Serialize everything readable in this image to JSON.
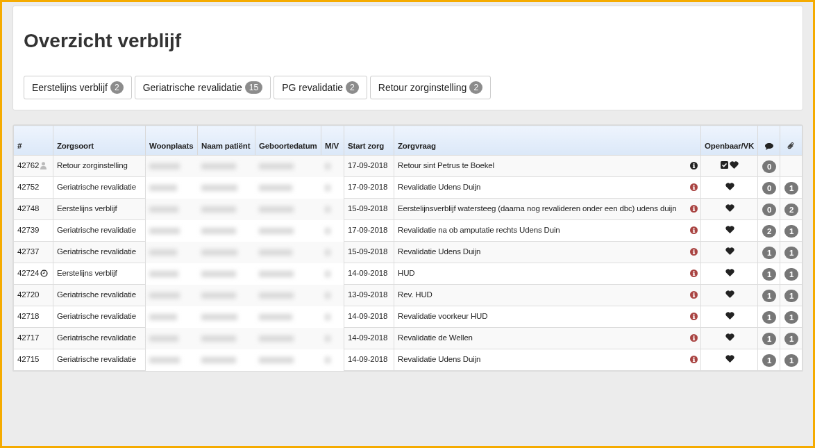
{
  "page": {
    "title": "Overzicht verblijf"
  },
  "filters": [
    {
      "label": "Eerstelijns verblijf",
      "count": "2"
    },
    {
      "label": "Geriatrische revalidatie",
      "count": "15"
    },
    {
      "label": "PG revalidatie",
      "count": "2"
    },
    {
      "label": "Retour zorginstelling",
      "count": "2"
    }
  ],
  "table": {
    "columns": [
      "#",
      "Zorgsoort",
      "Woonplaats",
      "Naam patiënt",
      "Geboortedatum",
      "M/V",
      "Start zorg",
      "Zorgvraag",
      "Openbaar/VK"
    ],
    "rows": [
      {
        "id": "42762",
        "kind": "person",
        "zorgsoort": "Retour zorginstelling",
        "start": "17-09-2018",
        "zorgvraag": "Retour sint Petrus te Boekel",
        "color": "#222222",
        "openbaar": true,
        "comments": "0"
      },
      {
        "id": "42752",
        "kind": "plain",
        "zorgsoort": "Geriatrische revalidatie",
        "start": "17-09-2018",
        "zorgvraag": "Revalidatie Udens Duijn",
        "color": "#a94442",
        "openbaar": false,
        "comments": "0",
        "attachments": "1"
      },
      {
        "id": "42748",
        "kind": "plain",
        "zorgsoort": "Eerstelijns verblijf",
        "start": "15-09-2018",
        "zorgvraag": "Eerstelijnsverblijf watersteeg (daarna nog revalideren onder een dbc) udens duijn",
        "color": "#a94442",
        "openbaar": false,
        "comments": "0",
        "attachments": "2"
      },
      {
        "id": "42739",
        "kind": "plain",
        "zorgsoort": "Geriatrische revalidatie",
        "start": "17-09-2018",
        "zorgvraag": "Revalidatie na ob amputatie rechts Udens Duin",
        "color": "#a94442",
        "openbaar": false,
        "comments": "2",
        "attachments": "1"
      },
      {
        "id": "42737",
        "kind": "plain",
        "zorgsoort": "Geriatrische revalidatie",
        "start": "15-09-2018",
        "zorgvraag": "Revalidatie Udens Duijn",
        "color": "#a94442",
        "openbaar": false,
        "comments": "1",
        "attachments": "1"
      },
      {
        "id": "42724",
        "kind": "clock",
        "zorgsoort": "Eerstelijns verblijf",
        "start": "14-09-2018",
        "zorgvraag": "HUD",
        "color": "#a94442",
        "openbaar": false,
        "comments": "1",
        "attachments": "1"
      },
      {
        "id": "42720",
        "kind": "plain",
        "zorgsoort": "Geriatrische revalidatie",
        "start": "13-09-2018",
        "zorgvraag": "Rev. HUD",
        "color": "#a94442",
        "openbaar": false,
        "comments": "1",
        "attachments": "1"
      },
      {
        "id": "42718",
        "kind": "plain",
        "zorgsoort": "Geriatrische revalidatie",
        "start": "14-09-2018",
        "zorgvraag": "Revalidatie voorkeur HUD",
        "color": "#a94442",
        "openbaar": false,
        "comments": "1",
        "attachments": "1"
      },
      {
        "id": "42717",
        "kind": "plain",
        "zorgsoort": "Geriatrische revalidatie",
        "start": "14-09-2018",
        "zorgvraag": "Revalidatie de Wellen",
        "color": "#a94442",
        "openbaar": false,
        "comments": "1",
        "attachments": "1"
      },
      {
        "id": "42715",
        "kind": "plain",
        "zorgsoort": "Geriatrische revalidatie",
        "start": "14-09-2018",
        "zorgvraag": "Revalidatie Udens Duijn",
        "color": "#a94442",
        "openbaar": false,
        "comments": "1",
        "attachments": "1"
      }
    ]
  }
}
